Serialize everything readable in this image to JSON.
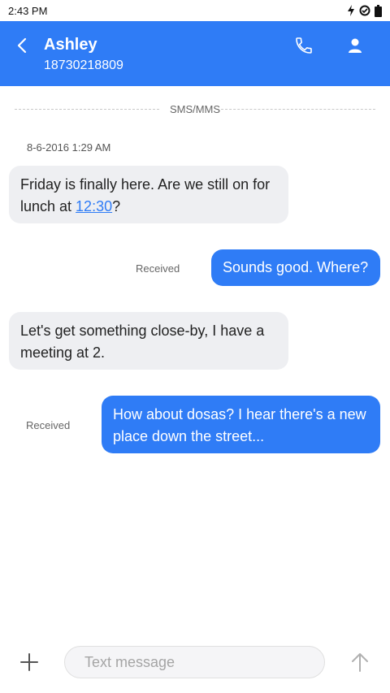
{
  "status": {
    "time": "2:43 PM"
  },
  "header": {
    "name": "Ashley",
    "number": "18730218809"
  },
  "thread": {
    "channel_label": "SMS/MMS",
    "date": "8-6-2016 1:29 AM",
    "messages": [
      {
        "direction": "in",
        "text_before": "Friday is finally here. Are we still on for lunch at ",
        "link": "12:30",
        "text_after": "?"
      },
      {
        "direction": "out",
        "text": "Sounds good. Where?",
        "status": "Received"
      },
      {
        "direction": "in",
        "text": "Let's get something close-by, I have a meeting at 2."
      },
      {
        "direction": "out",
        "text": "How about dosas? I hear there's a new place down the street...",
        "status": "Received"
      }
    ]
  },
  "composer": {
    "placeholder": "Text message",
    "value": ""
  },
  "colors": {
    "accent": "#2f7cf6",
    "incoming_bubble": "#eeeff2"
  },
  "icons": [
    "back-arrow-icon",
    "phone-icon",
    "person-icon",
    "add-icon",
    "send-arrow-icon",
    "flash-icon",
    "sync-icon",
    "battery-icon"
  ]
}
